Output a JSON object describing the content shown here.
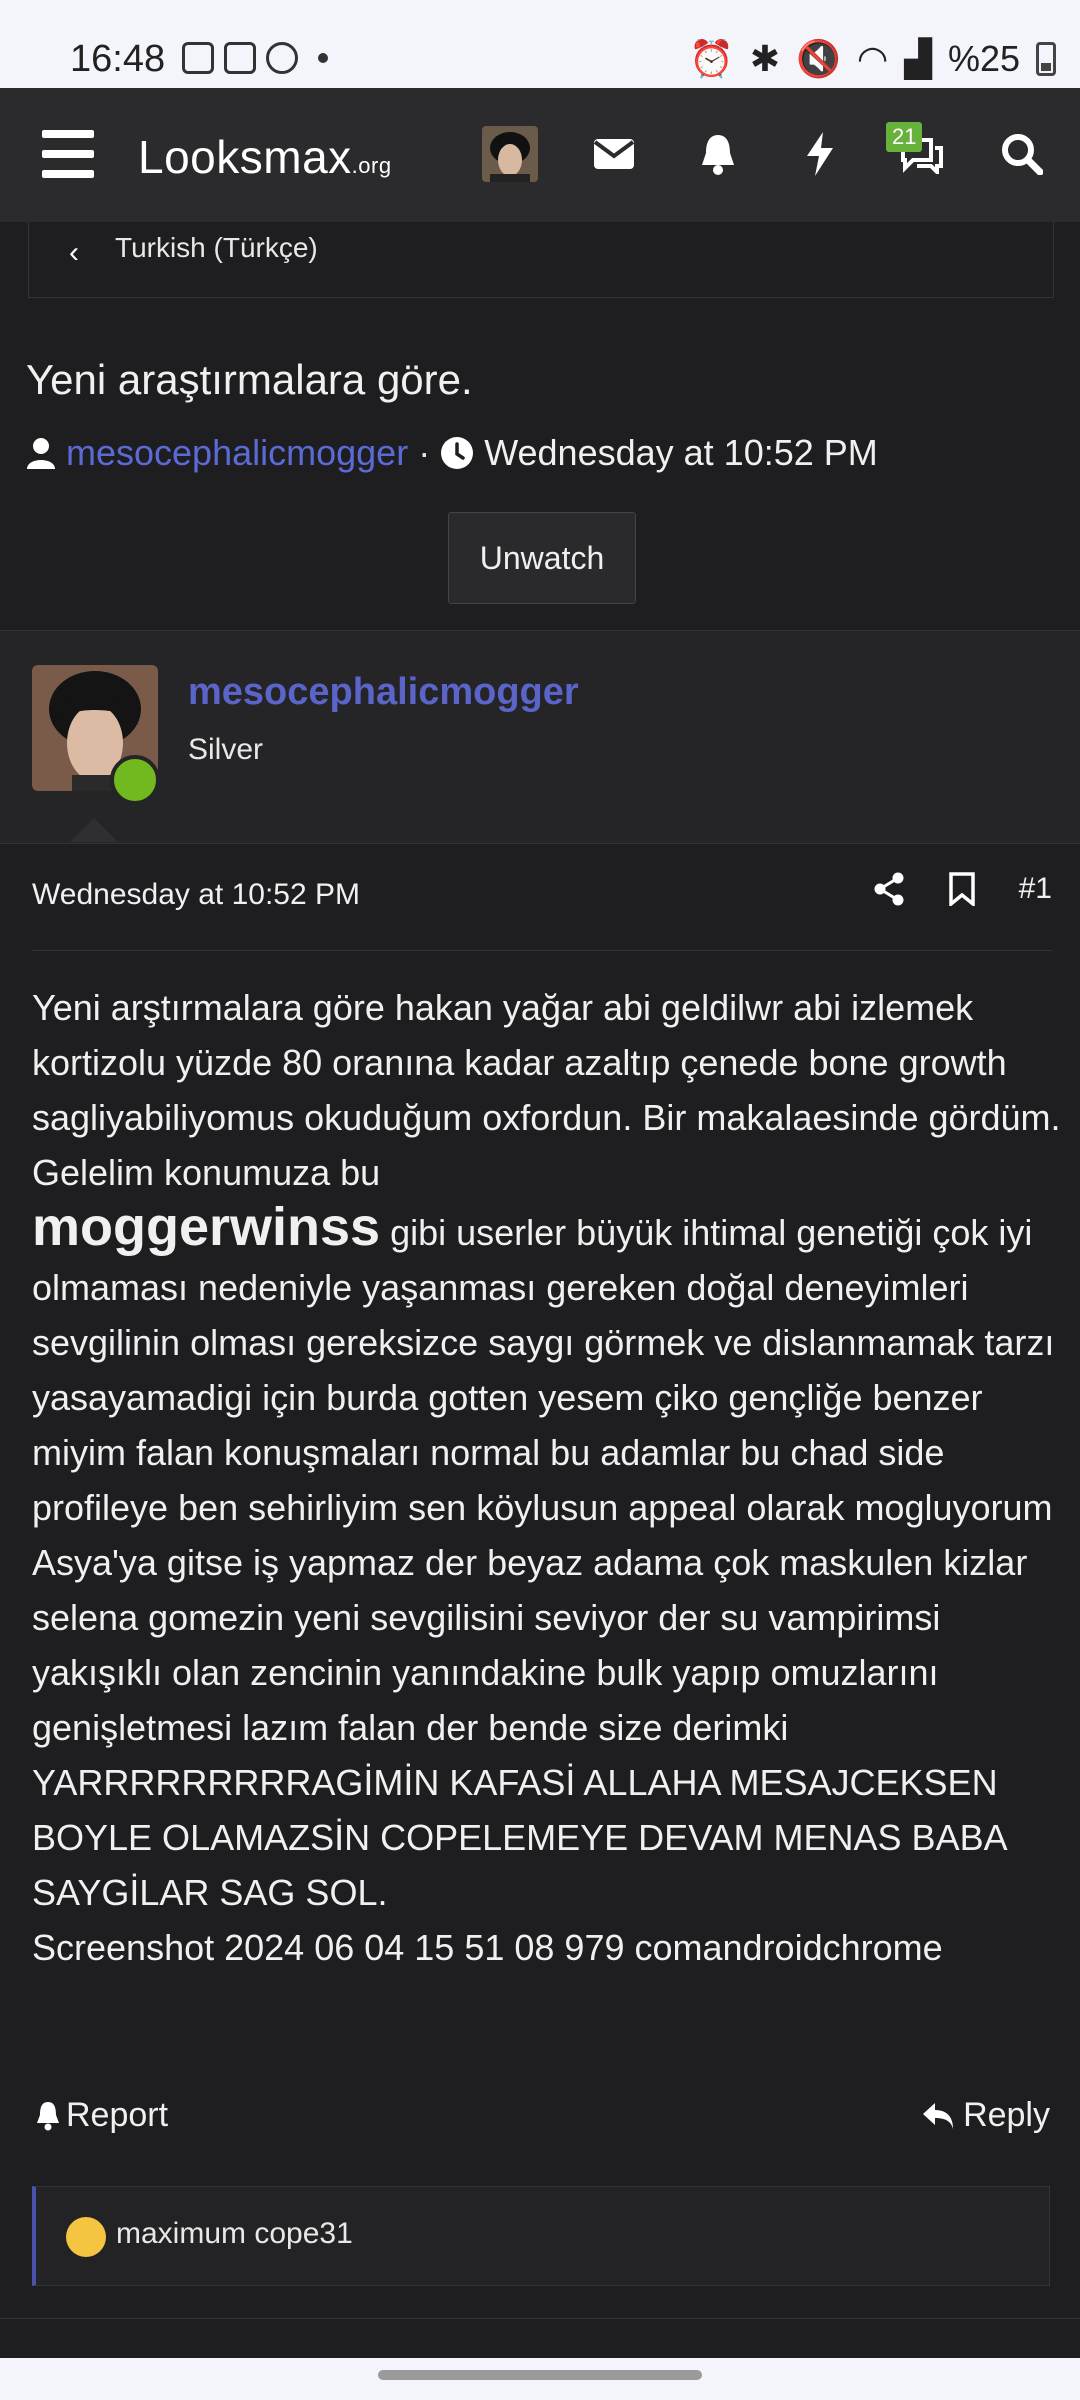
{
  "status_bar": {
    "time": "16:48",
    "battery": "%25"
  },
  "nav": {
    "logo_main": "Looksmax",
    "logo_suffix": ".org",
    "chat_badge": "21",
    "icons": [
      "menu-icon",
      "avatar",
      "envelope-icon",
      "bell-icon",
      "bolt-icon",
      "chat-icon",
      "search-icon"
    ]
  },
  "breadcrumb": {
    "label": "Turkish (Türkçe)"
  },
  "thread": {
    "title": "Yeni araştırmalara göre.",
    "author": "mesocephalicmogger",
    "separator": "·",
    "date": "Wednesday at 10:52 PM",
    "unwatch_label": "Unwatch"
  },
  "post": {
    "username": "mesocephalicmogger",
    "rank": "Silver",
    "date": "Wednesday at 10:52 PM",
    "number": "#1",
    "text_before": "Yeni arştırmalara göre hakan yağar abi geldilwr abi izlemek kortizolu yüzde 80 oranına kadar azaltıp çenede bone growth sagliyabiliyomus okuduğum oxfordun. Bir makalaesinde gördüm. Gelelim konumuza bu",
    "big_word": "moggerwinss",
    "text_after": " gibi userler büyük ihtimal genetiği çok iyi olmaması nedeniyle yaşanması gereken doğal deneyimleri sevgilinin olması gereksizce saygı görmek ve dislanmamak tarzı yasayamadigi için burda gotten yesem çiko gençliğe benzer miyim falan konuşmaları normal bu adamlar bu chad side profileye ben sehirliyim sen köylusun appeal olarak mogluyorum Asya'ya gitse iş yapmaz der beyaz adama çok maskulen kizlar selena gomezin yeni sevgilisini seviyor der su vampirimsi yakışıklı olan zencinin yanındakine bulk yapıp omuzlarını genişletmesi lazım falan der bende size derimki YARRRRRRRRRAGİMİN KAFASİ ALLAHA MESAJCEKSEN BOYLE OLAMAZSİN COPELEMEYE DEVAM MENAS BABA SAYGİLAR SAG SOL.",
    "attachment": "Screenshot 2024 06 04 15 51 08 979 comandroidchrome",
    "report_label": "Report",
    "reply_label": "Reply"
  },
  "reactions": {
    "text": "maximum cope31"
  }
}
